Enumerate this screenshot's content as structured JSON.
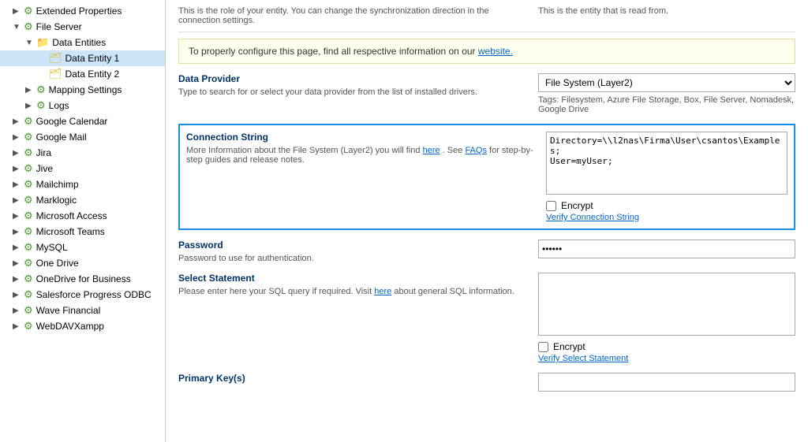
{
  "sidebar": {
    "items": [
      {
        "id": "extended-properties",
        "label": "Extended Properties",
        "level": 1,
        "type": "gear",
        "expanded": false,
        "selected": false
      },
      {
        "id": "file-server",
        "label": "File Server",
        "level": 1,
        "type": "gear",
        "expanded": true,
        "selected": false
      },
      {
        "id": "data-entities",
        "label": "Data Entities",
        "level": 2,
        "type": "folder",
        "expanded": true,
        "selected": false
      },
      {
        "id": "data-entity-1",
        "label": "Data Entity 1",
        "level": 3,
        "type": "entity",
        "selected": true
      },
      {
        "id": "data-entity-2",
        "label": "Data Entity 2",
        "level": 3,
        "type": "entity",
        "selected": false
      },
      {
        "id": "mapping-settings",
        "label": "Mapping Settings",
        "level": 2,
        "type": "gear",
        "selected": false
      },
      {
        "id": "logs",
        "label": "Logs",
        "level": 2,
        "type": "gear",
        "selected": false
      },
      {
        "id": "google-calendar",
        "label": "Google Calendar",
        "level": 1,
        "type": "gear",
        "selected": false
      },
      {
        "id": "google-mail",
        "label": "Google Mail",
        "level": 1,
        "type": "gear",
        "selected": false
      },
      {
        "id": "jira",
        "label": "Jira",
        "level": 1,
        "type": "gear",
        "selected": false
      },
      {
        "id": "jive",
        "label": "Jive",
        "level": 1,
        "type": "gear",
        "selected": false
      },
      {
        "id": "mailchimp",
        "label": "Mailchimp",
        "level": 1,
        "type": "gear",
        "selected": false
      },
      {
        "id": "marklogic",
        "label": "Marklogic",
        "level": 1,
        "type": "gear",
        "selected": false
      },
      {
        "id": "microsoft-access",
        "label": "Microsoft Access",
        "level": 1,
        "type": "gear",
        "selected": false
      },
      {
        "id": "microsoft-teams",
        "label": "Microsoft Teams",
        "level": 1,
        "type": "gear",
        "selected": false
      },
      {
        "id": "mysql",
        "label": "MySQL",
        "level": 1,
        "type": "gear",
        "selected": false
      },
      {
        "id": "one-drive",
        "label": "One Drive",
        "level": 1,
        "type": "gear",
        "selected": false
      },
      {
        "id": "onedrive-business",
        "label": "OneDrive for Business",
        "level": 1,
        "type": "gear",
        "selected": false
      },
      {
        "id": "salesforce-progress",
        "label": "Salesforce Progress ODBC",
        "level": 1,
        "type": "gear",
        "selected": false
      },
      {
        "id": "wave-financial",
        "label": "Wave Financial",
        "level": 1,
        "type": "gear",
        "selected": false
      },
      {
        "id": "webdav-xampp",
        "label": "WebDAVXampp",
        "level": 1,
        "type": "gear",
        "selected": false
      }
    ]
  },
  "main": {
    "entity_type": {
      "left_desc": "This is the role of your entity. You can change the synchronization direction in the connection settings.",
      "right_desc": "This is the entity that is read from."
    },
    "info_banner": {
      "text_before": "To properly configure this page, find all respective information on our",
      "link_text": "website.",
      "text_after": ""
    },
    "data_provider": {
      "label": "Data Provider",
      "desc": "Type to search for or select your data provider from the list of installed drivers.",
      "value": "File System (Layer2)",
      "tags": "Tags: Filesystem, Azure File Storage, Box, File Server, Nomadesk, Google Drive"
    },
    "connection_string": {
      "label": "Connection String",
      "desc_before": "More Information about the File System (Layer2) you will find",
      "here_link": "here",
      "desc_middle": ". See",
      "faqs_link": "FAQs",
      "desc_after": "for step-by-step guides and release notes.",
      "value": "Directory=\\\\l2nas\\Firma\\User\\csantos\\Examples;\nUser=myUser;",
      "encrypt_label": "Encrypt",
      "verify_link": "Verify Connection String"
    },
    "password": {
      "label": "Password",
      "desc": "Password to use for authentication.",
      "value": "••••••"
    },
    "select_statement": {
      "label": "Select Statement",
      "desc_before": "Please enter here your SQL query if required. Visit",
      "here_link": "here",
      "desc_after": "about general SQL information.",
      "value": "",
      "encrypt_label": "Encrypt",
      "verify_link": "Verify Select Statement"
    },
    "primary_keys": {
      "label": "Primary Key(s)",
      "value": ""
    }
  }
}
